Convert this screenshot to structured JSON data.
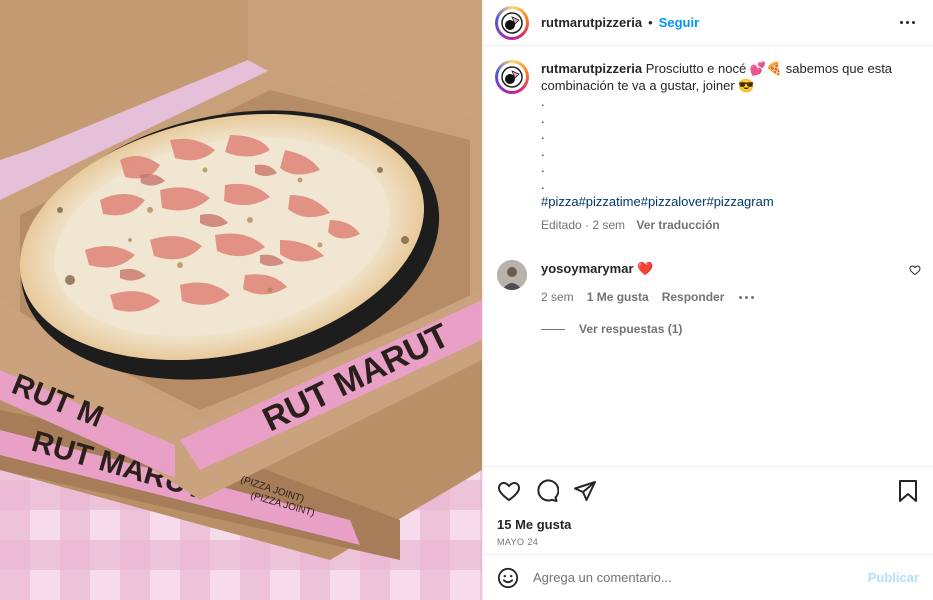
{
  "photo": {
    "box_text_1": "RUT MARUT",
    "box_text_2": "RUT M",
    "box_text_3": "RUT MARUT",
    "box_text_4": "(PIZZA JOINT)",
    "box_text_5": "(PIZZA JOINT)"
  },
  "header": {
    "username": "rutmarutpizzeria",
    "separator": "•",
    "follow_label": "Seguir"
  },
  "caption": {
    "username": "rutmarutpizzeria",
    "text": "Prosciutto e nocé 💕🍕 sabemos que esta combinación te va a gustar, joiner 😎",
    "dots": [
      ".",
      ".",
      ".",
      ".",
      ".",
      "."
    ],
    "hashtags": "#pizza#pizzatime#pizzalover#pizzagram",
    "edited": "Editado · 2 sem",
    "translate": "Ver traducción"
  },
  "comment": {
    "username": "yosoymarymar",
    "text": "❤️",
    "age": "2 sem",
    "likes": "1 Me gusta",
    "reply": "Responder",
    "view_replies": "Ver respuestas (1)"
  },
  "actions": {
    "likes": "15 Me gusta",
    "date": "MAYO 24"
  },
  "add_comment": {
    "placeholder": "Agrega un comentario...",
    "publish": "Publicar"
  },
  "icons": [
    "more-icon",
    "heart-icon",
    "comment-icon",
    "share-icon",
    "bookmark-icon",
    "emoji-icon",
    "small-heart-icon"
  ],
  "colors": {
    "follow": "#0095f6",
    "hashtag": "#00376b",
    "publish_disabled": "#b2dffc",
    "box_pink": "#e8a0c6"
  }
}
